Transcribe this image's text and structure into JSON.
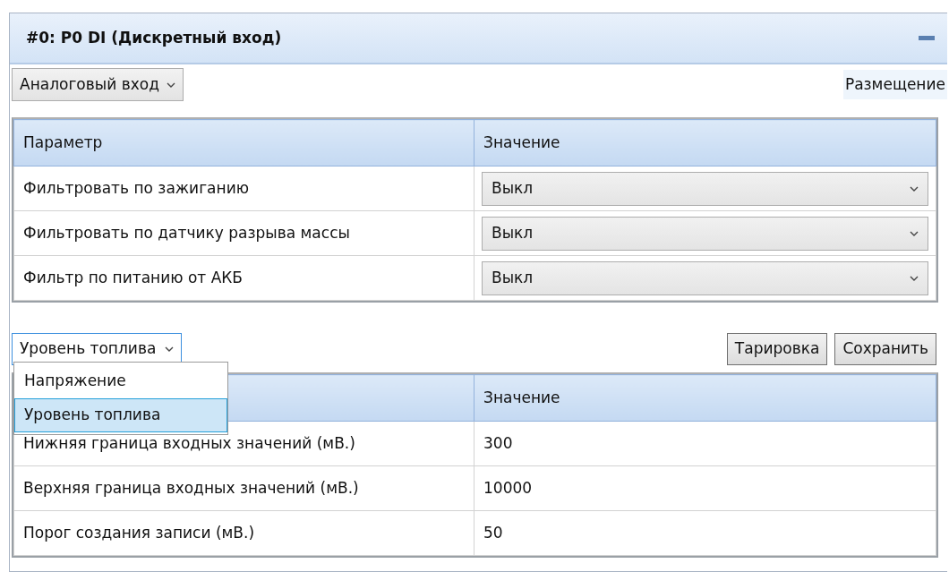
{
  "panel": {
    "title": "#0: P0 DI (Дискретный вход)"
  },
  "input_type": {
    "value": "Аналоговый вход"
  },
  "placement_tab": {
    "label": "Размещение"
  },
  "params_table": {
    "columns": [
      "Параметр",
      "Значение"
    ],
    "rows": [
      {
        "name": "Фильтровать по зажиганию",
        "value": "Выкл"
      },
      {
        "name": "Фильтровать по датчику разрыва массы",
        "value": "Выкл"
      },
      {
        "name": "Фильтр по питанию от АКБ",
        "value": "Выкл"
      }
    ]
  },
  "sensor_select": {
    "value": "Уровень топлива",
    "expanded": true,
    "options": [
      {
        "label": "Напряжение",
        "selected": false
      },
      {
        "label": "Уровень топлива",
        "selected": true
      }
    ]
  },
  "buttons": [
    {
      "label": "Тарировка"
    },
    {
      "label": "Сохранить"
    }
  ],
  "sensor_table": {
    "value_column": "Значение",
    "rows": [
      {
        "name": "Нижняя граница входных значений (мВ.)",
        "value": "300"
      },
      {
        "name": "Верхняя граница входных значений (мВ.)",
        "value": "10000"
      },
      {
        "name": "Порог создания записи (мВ.)",
        "value": "50"
      }
    ]
  }
}
